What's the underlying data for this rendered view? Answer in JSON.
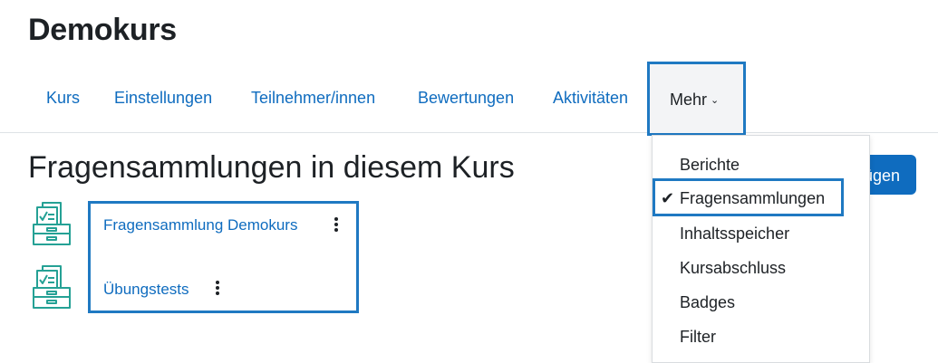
{
  "course": {
    "title": "Demokurs"
  },
  "nav": {
    "items": [
      {
        "label": "Kurs"
      },
      {
        "label": "Einstellungen"
      },
      {
        "label": "Teilnehmer/innen"
      },
      {
        "label": "Bewertungen"
      },
      {
        "label": "Aktivitäten"
      }
    ],
    "more_label": "Mehr",
    "more_menu": {
      "items": [
        {
          "label": "Berichte"
        },
        {
          "label": "Fragensammlungen",
          "selected": true
        },
        {
          "label": "Inhaltsspeicher"
        },
        {
          "label": "Kursabschluss"
        },
        {
          "label": "Badges"
        },
        {
          "label": "Filter"
        }
      ]
    }
  },
  "page": {
    "heading": "Fragensammlungen in diesem Kurs",
    "add_button_label": "ügen"
  },
  "banks": [
    {
      "name": "Fragensammlung Demokurs",
      "icon": "question-bank-icon"
    },
    {
      "name": "Übungstests",
      "icon": "question-bank-icon"
    }
  ],
  "colors": {
    "link": "#0f6cbf",
    "highlight": "#1f79c2",
    "icon": "#25a195"
  }
}
